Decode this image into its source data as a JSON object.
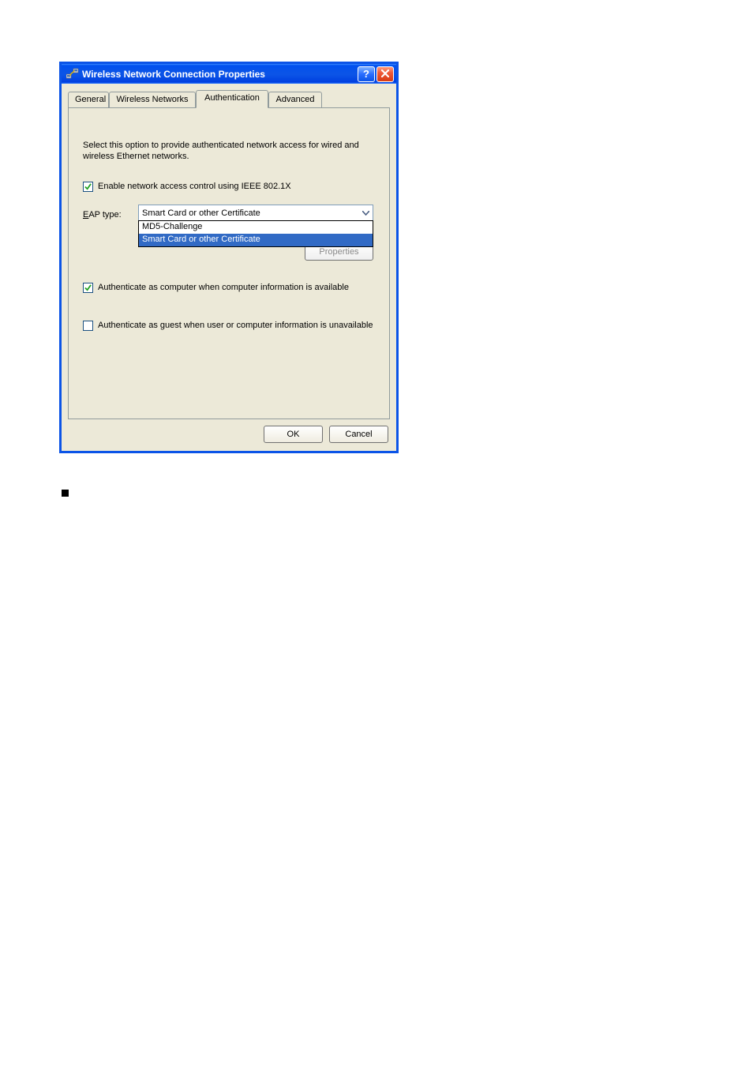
{
  "window": {
    "title": "Wireless Network Connection Properties"
  },
  "tabs": {
    "general": "General",
    "wireless": "Wireless Networks",
    "authentication": "Authentication",
    "advanced": "Advanced"
  },
  "body": {
    "description": "Select this option to provide authenticated network access for wired and wireless Ethernet networks.",
    "enable_8021x_label": "Enable network access control using IEEE 802.1X",
    "eap_type_label": "EAP type:",
    "eap_type_underline_char": "E",
    "eap_selected": "Smart Card or other Certificate",
    "eap_options": [
      "MD5-Challenge",
      "Smart Card or other Certificate"
    ],
    "properties_btn": "Properties",
    "auth_as_computer_label": "Authenticate as computer when computer information is available",
    "auth_as_guest_label": "Authenticate as guest when user or computer information is unavailable"
  },
  "buttons": {
    "ok": "OK",
    "cancel": "Cancel"
  },
  "titlebar_buttons": {
    "help": "?",
    "close": "X"
  }
}
